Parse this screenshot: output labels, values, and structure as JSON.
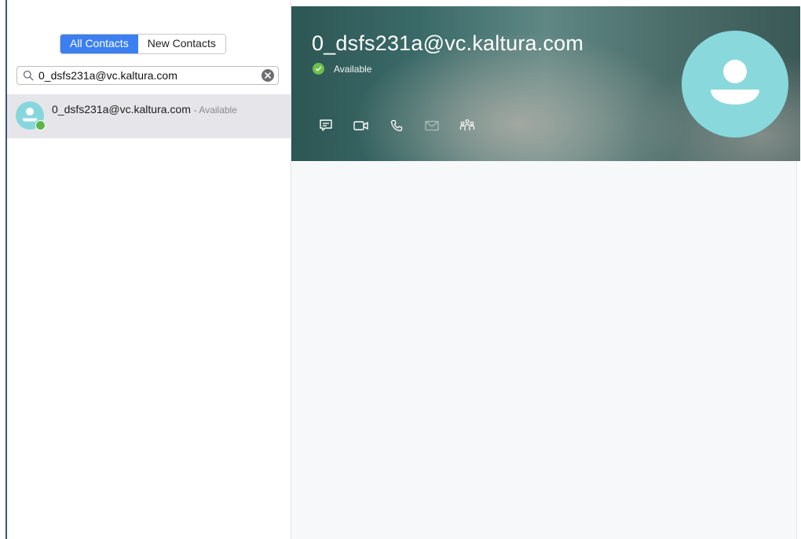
{
  "sidebar": {
    "tabs": [
      {
        "label": "All Contacts",
        "active": true
      },
      {
        "label": "New Contacts",
        "active": false
      }
    ],
    "search": {
      "value": "0_dsfs231a@vc.kaltura.com",
      "placeholder": ""
    },
    "results": [
      {
        "name": "0_dsfs231a@vc.kaltura.com",
        "status": "- Available"
      }
    ]
  },
  "profile": {
    "name": "0_dsfs231a@vc.kaltura.com",
    "status": "Available",
    "actions": [
      {
        "icon": "chat-icon",
        "enabled": true
      },
      {
        "icon": "video-call-icon",
        "enabled": true
      },
      {
        "icon": "phone-call-icon",
        "enabled": true
      },
      {
        "icon": "email-icon",
        "enabled": false
      },
      {
        "icon": "meeting-icon",
        "enabled": true
      }
    ]
  },
  "colors": {
    "accent": "#3b7ff1",
    "available": "#6fbf4b",
    "avatar": "#89d8dc",
    "selected_row": "#e6e6ea",
    "window_border": "#36557a"
  }
}
